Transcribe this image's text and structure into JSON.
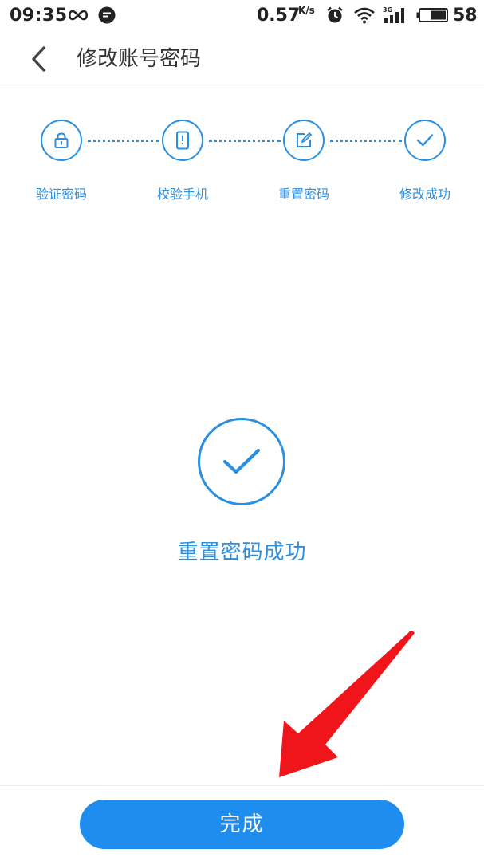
{
  "status_bar": {
    "time": "09:35",
    "speed": "0.57",
    "speed_unit": "K/s",
    "battery_level": "58",
    "icons": [
      "infinity-icon",
      "message-icon",
      "alarm-icon",
      "wifi-icon",
      "signal-3g-icon",
      "battery-icon"
    ]
  },
  "header": {
    "title": "修改账号密码",
    "back_icon": "chevron-left-icon"
  },
  "stepper": {
    "steps": [
      {
        "label": "验证密码",
        "icon": "lock-icon"
      },
      {
        "label": "校验手机",
        "icon": "phone-icon"
      },
      {
        "label": "重置密码",
        "icon": "edit-icon"
      },
      {
        "label": "修改成功",
        "icon": "check-icon"
      }
    ]
  },
  "result": {
    "message": "重置密码成功",
    "icon": "check-circle-icon"
  },
  "footer": {
    "done_label": "完成"
  },
  "colors": {
    "accent": "#2b8fe0",
    "button": "#1f8ded",
    "annotation": "#f0151b",
    "title_text": "#333333"
  }
}
